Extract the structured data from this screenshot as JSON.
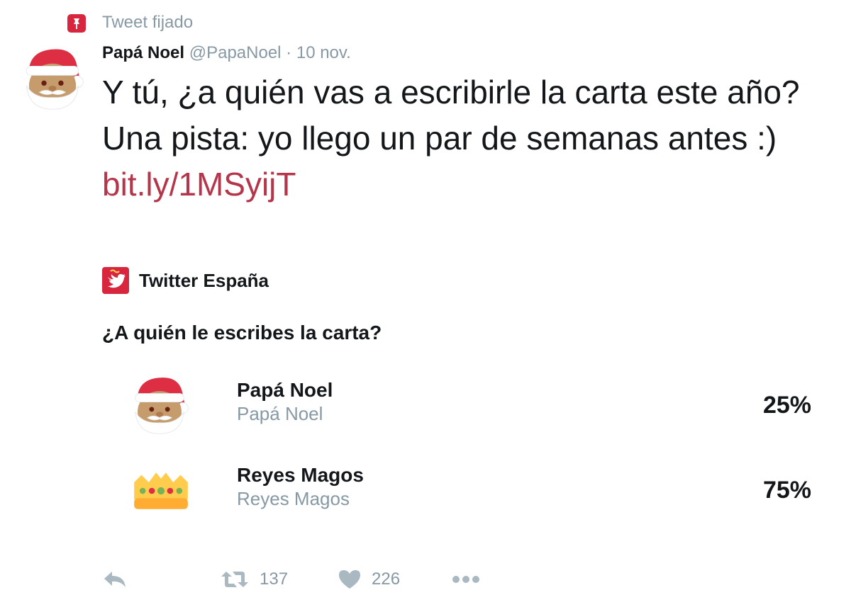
{
  "pinned": {
    "label": "Tweet fijado",
    "icon": "pin-icon"
  },
  "author": {
    "name": "Papá Noel",
    "handle": "@PapaNoel",
    "separator": "·",
    "date": "10 nov.",
    "avatar_icon": "santa-avatar-icon"
  },
  "tweet": {
    "text": "Y tú, ¿a quién vas a escribirle la carta este año? Una pista: yo llego un par de semanas antes :)",
    "link": "bit.ly/1MSyijT"
  },
  "sponsor": {
    "name": "Twitter España",
    "icon": "twitter-espana-logo-icon"
  },
  "poll": {
    "question": "¿A quién le escribes la carta?",
    "options": [
      {
        "title": "Papá Noel",
        "subtitle": "Papá Noel",
        "percent": "25%",
        "icon": "santa-emoji-icon"
      },
      {
        "title": "Reyes Magos",
        "subtitle": "Reyes Magos",
        "percent": "75%",
        "icon": "crown-emoji-icon"
      }
    ]
  },
  "actions": {
    "reply_icon": "reply-icon",
    "retweet_icon": "retweet-icon",
    "retweet_count": "137",
    "like_icon": "heart-icon",
    "like_count": "226",
    "more_icon": "more-icon"
  },
  "colors": {
    "link": "#b5364a",
    "muted": "#8899a6",
    "text": "#14171a",
    "brand_red": "#d7263d",
    "icon_gray": "#aab8c2"
  }
}
